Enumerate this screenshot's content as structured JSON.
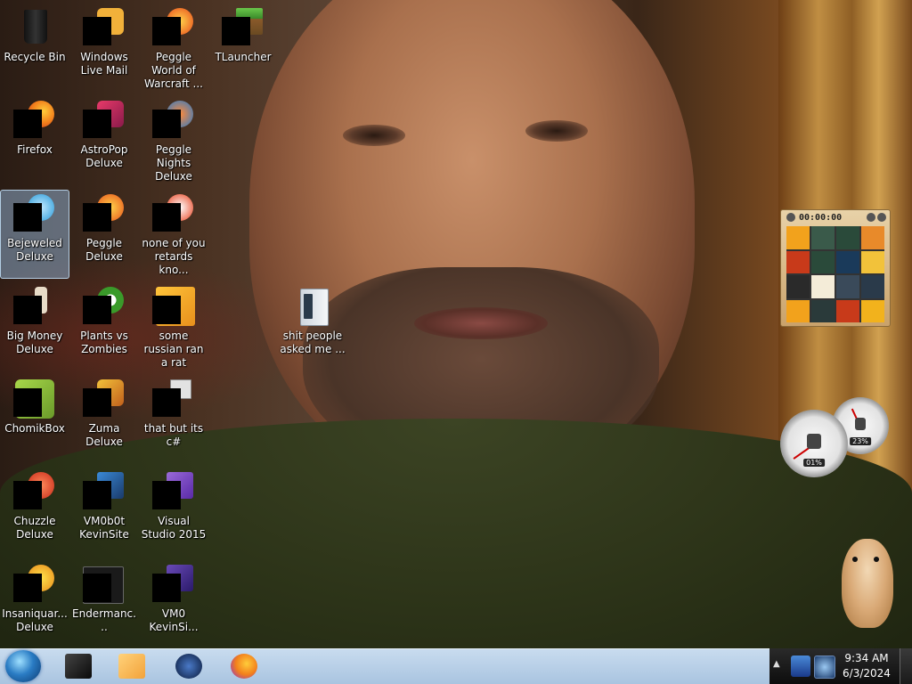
{
  "desktop": {
    "icons": [
      {
        "label": "Recycle Bin",
        "icon": "recycle-bin-icon",
        "color": "#1a1a1a"
      },
      {
        "label": "Windows Live Mail",
        "icon": "windows-live-mail-icon",
        "color": "#f2b13a"
      },
      {
        "label": "Peggle World of Warcraft ...",
        "icon": "peggle-world-of-warcraft-icon",
        "color": "#e84a1c"
      },
      {
        "label": "TLauncher",
        "icon": "tlauncher-icon",
        "color": "#4aa83a"
      },
      {
        "label": "Firefox",
        "icon": "firefox-icon",
        "color": "#f2801c"
      },
      {
        "label": "AstroPop Deluxe",
        "icon": "astropop-deluxe-icon",
        "color": "#c02a6a"
      },
      {
        "label": "Peggle Nights Deluxe",
        "icon": "peggle-nights-deluxe-icon",
        "color": "#2a7ac8"
      },
      {
        "label": "Bejeweled Deluxe",
        "icon": "bejeweled-deluxe-icon",
        "color": "#2a9ad8"
      },
      {
        "label": "Peggle Deluxe",
        "icon": "peggle-deluxe-icon",
        "color": "#e8541c"
      },
      {
        "label": "none of you retards kno...",
        "icon": "peggle-shortcut-icon",
        "color": "#e8401c"
      },
      {
        "label": "Big Money Deluxe",
        "icon": "big-money-deluxe-icon",
        "color": "#d8c8a8"
      },
      {
        "label": "Plants vs Zombies",
        "icon": "plants-vs-zombies-icon",
        "color": "#3a9a2a"
      },
      {
        "label": "some russian ran a rat",
        "icon": "orange-app-icon",
        "color": "#f2a21c"
      },
      {
        "label": "shit people asked me ...",
        "icon": "folder-icon",
        "color": "#d8dde2"
      },
      {
        "label": "ChomikBox",
        "icon": "chomikbox-icon",
        "color": "#8ab83a"
      },
      {
        "label": "Zuma Deluxe",
        "icon": "zuma-deluxe-icon",
        "color": "#e8a21c"
      },
      {
        "label": "that but its c#",
        "icon": "multiple-windows-icon",
        "color": "#d8d8d8"
      },
      {
        "label": "Chuzzle Deluxe",
        "icon": "chuzzle-deluxe-icon",
        "color": "#e83a2a"
      },
      {
        "label": "VM0b0t KevinSite",
        "icon": "vm-shortcut-icon",
        "color": "#2a6ab8"
      },
      {
        "label": "Visual Studio 2015",
        "icon": "visual-studio-icon",
        "color": "#6a3ab8"
      },
      {
        "label": "Insaniquar... Deluxe",
        "icon": "insaniquarium-deluxe-icon",
        "color": "#e8a21c"
      },
      {
        "label": "Endermanc...",
        "icon": "terminal-app-icon",
        "color": "#1a1a1a"
      },
      {
        "label": "VM0 KevinSi...",
        "icon": "vm-shortcut-2-icon",
        "color": "#5a3aa8"
      }
    ]
  },
  "gadgets": {
    "puzzle": {
      "timer": "00:00:00"
    },
    "cpu_meter": {
      "cpu_label": "01%",
      "ram_label": "23%"
    }
  },
  "taskbar": {
    "pinned": [
      {
        "name": "cmd-taskbar-button",
        "icon": "terminal-icon",
        "color": "#1c1c1c"
      },
      {
        "name": "media-player-taskbar-button",
        "icon": "media-player-icon",
        "color": "#f2a23a"
      },
      {
        "name": "globe-taskbar-button",
        "icon": "globe-icon",
        "color": "#1a3a6a"
      },
      {
        "name": "firefox-taskbar-button",
        "icon": "firefox-icon",
        "color": "#f2801c"
      }
    ],
    "clock": {
      "time": "9:34 AM",
      "date": "6/3/2024"
    }
  }
}
